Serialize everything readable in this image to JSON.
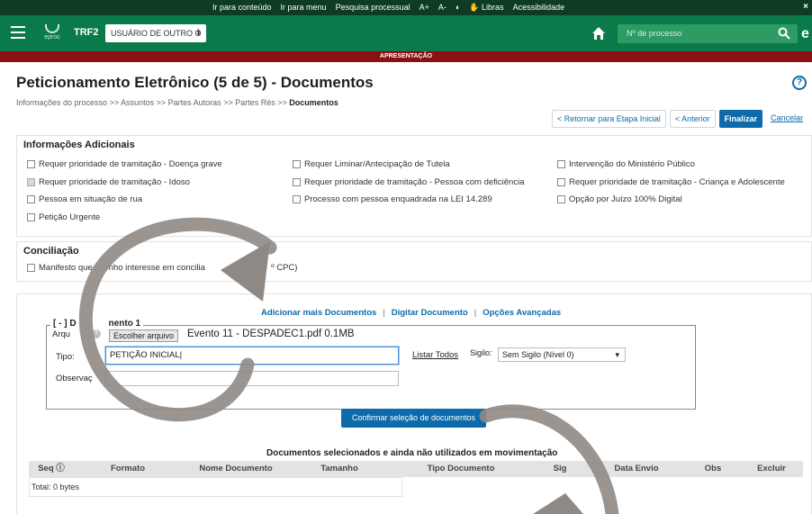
{
  "accessbar": {
    "links": [
      "Ir para conteúdo",
      "Ir para menu",
      "Pesquisa processual",
      "A+",
      "A-",
      "◐",
      "✋ Libras",
      "Acessibilidade"
    ],
    "close": "×"
  },
  "header": {
    "logo_text": "eproc",
    "org": "TRF2",
    "user_select": "USUÁRIO DE OUTRO Ó",
    "search_placeholder": "Nº de processo",
    "edge_letter": "e"
  },
  "redbar": {
    "label": "APRESENTAÇÃO"
  },
  "page": {
    "title": "Peticionamento Eletrônico (5 de 5) - Documentos",
    "help": "?",
    "breadcrumb": {
      "items": [
        "Informações do processo",
        "Assuntos",
        "Partes Autoras",
        "Partes Rés"
      ],
      "separator": " >> ",
      "current": "Documentos"
    }
  },
  "actions": {
    "back_start": "< Retornar para Etapa Inicial",
    "previous": "< Anterior",
    "finish": "Finalizar",
    "cancel": "Cancelar"
  },
  "info": {
    "title": "Informações Adicionais",
    "options": [
      {
        "label": "Requer prioridade de tramitação - Doença grave",
        "disabled": false
      },
      {
        "label": "Requer Liminar/Antecipação de Tutela",
        "disabled": false
      },
      {
        "label": "Intervenção do Ministério Público",
        "disabled": false
      },
      {
        "label": "Requer prioridade de tramitação - Idoso",
        "disabled": true
      },
      {
        "label": "Requer prioridade de tramitação - Pessoa com deficiência",
        "disabled": false
      },
      {
        "label": "Requer prioridade de tramitação - Criança e Adolescente",
        "disabled": false
      },
      {
        "label": "Pessoa em situação de rua",
        "disabled": false
      },
      {
        "label": "Processo com pessoa enquadrada na LEI 14.289",
        "disabled": false
      },
      {
        "label": "Opção por Juízo 100% Digital",
        "disabled": false
      },
      {
        "label": "Petição Urgente",
        "disabled": false
      }
    ]
  },
  "conciliation": {
    "title": "Conciliação",
    "option_part1": "Manifesto que",
    "option_part2": "nho interesse em concilia",
    "option_part3": "33,",
    "option_part4": "º CPC)"
  },
  "doc_links": {
    "add": "Adicionar mais Documentos",
    "type": "Digitar Documento",
    "advanced": "Opções Avançadas",
    "sep": "|"
  },
  "document": {
    "legend_prefix": "[ - ] D",
    "legend_suffix": "nento 1",
    "file_label": "Arqu",
    "file_button": "Escolher arquivo",
    "file_name": "Evento 11 - DESPADEC1.pdf 0.1MB",
    "type_label": "Tipo:",
    "type_value": "PETIÇÃO INICIAL",
    "list_all": "Listar Todos",
    "secrecy_label": "Sigilo:",
    "secrecy_value": "Sem Sigilo (Nível 0)",
    "obs_label": "Observaç"
  },
  "confirm_button": "Confirmar seleção de documentos",
  "table": {
    "title": "Documentos selecionados e ainda não utilizados em movimentação",
    "columns": [
      "Seq ⓘ",
      "Formato",
      "Nome Documento",
      "Tamanho",
      "Tipo Documento",
      "Sig",
      "Data Envio",
      "Obs",
      "Excluir"
    ],
    "total": "Total: 0 bytes"
  }
}
